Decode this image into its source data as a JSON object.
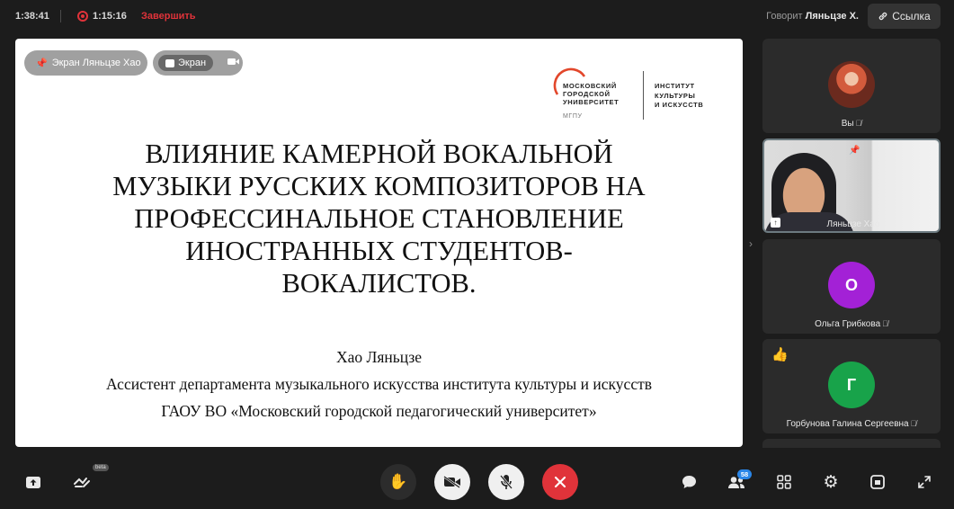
{
  "topbar": {
    "clock": "1:38:41",
    "recording_time": "1:15:16",
    "stop_label": "Завершить",
    "speaking_prefix": "Говорит",
    "speaking_name": "Ляньцзе Х.",
    "link_label": "Ссылка"
  },
  "stage": {
    "owner_chip": "Экран Ляньцзе Хао",
    "screen_chip": "Экран",
    "logo": {
      "university_lines": [
        "МОСКОВСКИЙ",
        "ГОРОДСКОЙ",
        "УНИВЕРСИТЕТ"
      ],
      "abbr": "МГПУ",
      "institute_lines": [
        "ИНСТИТУТ",
        "КУЛЬТУРЫ",
        "И ИСКУССТВ"
      ]
    },
    "title_lines": [
      "ВЛИЯНИЕ КАМЕРНОЙ ВОКАЛЬНОЙ",
      "МУЗЫКИ РУССКИХ КОМПОЗИТОРОВ НА",
      "ПРОФЕССИНАЛЬНОЕ СТАНОВЛЕНИЕ",
      "ИНОСТРАННЫХ СТУДЕНТОВ-",
      "ВОКАЛИСТОВ."
    ],
    "author": "Хао Ляньцзе",
    "affiliation_line1": "Ассистент департамента музыкального искусства института культуры и искусств",
    "affiliation_line2": "ГАОУ ВО «Московский городской педагогический университет»"
  },
  "participants": [
    {
      "name": "Вы",
      "avatar_type": "photo"
    },
    {
      "name": "Ляньцзе Хао",
      "avatar_type": "video"
    },
    {
      "name": "Ольга Грибкова",
      "initial": "О",
      "color": "#a321d6"
    },
    {
      "name": "Горбунова Галина Сергеевна",
      "initial": "Г",
      "color": "#18a34a",
      "reaction": "👍"
    }
  ],
  "toolbar": {
    "beta_label": "beta",
    "participants_count": "58"
  },
  "colors": {
    "background": "#1c1c1c",
    "record_red": "#e0333a",
    "badge_blue": "#2a86e8"
  }
}
